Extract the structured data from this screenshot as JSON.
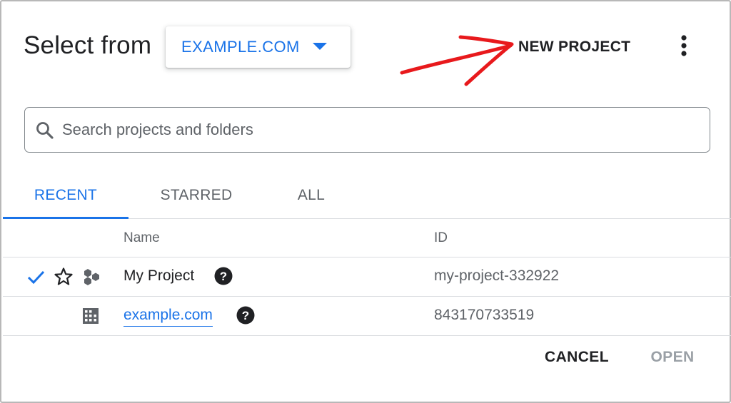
{
  "header": {
    "title": "Select from",
    "org_selector": {
      "label": "EXAMPLE.COM",
      "icon": "caret-down-icon"
    },
    "new_project_label": "NEW PROJECT",
    "more_icon": "more-vert-icon",
    "annotation": {
      "type": "hand-drawn arrow",
      "color": "#e8191c"
    }
  },
  "search": {
    "placeholder": "Search projects and folders",
    "value": "",
    "icon": "search-icon"
  },
  "tabs": [
    {
      "label": "RECENT",
      "active": true
    },
    {
      "label": "STARRED",
      "active": false
    },
    {
      "label": "ALL",
      "active": false
    }
  ],
  "table": {
    "columns": {
      "name": "Name",
      "id": "ID"
    },
    "rows": [
      {
        "name": "My Project",
        "id": "my-project-332922",
        "selected": true,
        "starred": false,
        "type": "project",
        "icons": [
          "check-icon",
          "star-outline-icon",
          "project-hexagons-icon",
          "help-icon"
        ]
      },
      {
        "name": "example.com",
        "id": "843170733519",
        "selected": false,
        "type": "organization",
        "icons": [
          "organization-building-icon",
          "help-icon"
        ]
      }
    ]
  },
  "footer": {
    "cancel_label": "CANCEL",
    "open_label": "OPEN"
  },
  "colors": {
    "accent": "#1a73e8",
    "text": "#202124",
    "secondary_text": "#5f6368",
    "disabled_text": "#9aa0a6",
    "divider": "#dadce0"
  }
}
